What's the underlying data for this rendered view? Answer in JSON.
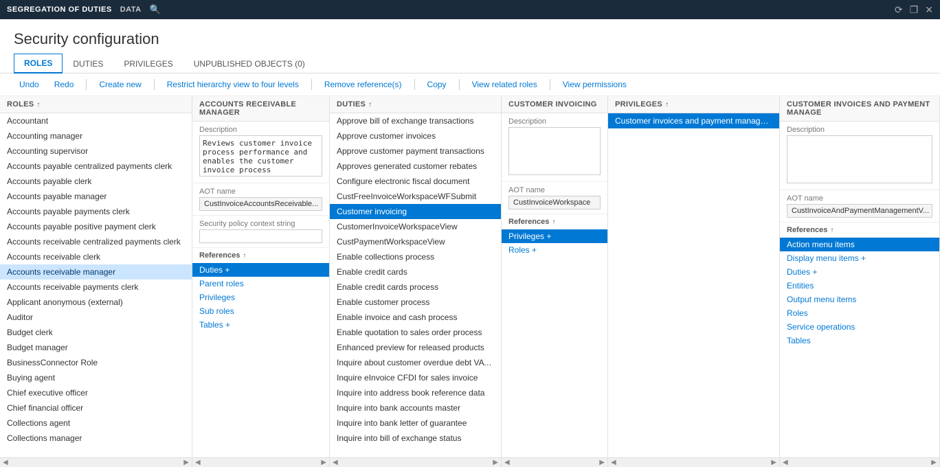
{
  "titleBar": {
    "appName": "SEGREGATION OF DUTIES",
    "menu": "DATA",
    "windowControls": [
      "⟳",
      "□",
      "✕"
    ]
  },
  "pageTitle": "Security configuration",
  "tabs": [
    {
      "label": "ROLES",
      "active": true
    },
    {
      "label": "DUTIES",
      "active": false
    },
    {
      "label": "PRIVILEGES",
      "active": false
    },
    {
      "label": "UNPUBLISHED OBJECTS (0)",
      "active": false
    }
  ],
  "toolbar": {
    "undo": "Undo",
    "redo": "Redo",
    "createNew": "Create new",
    "restrictHierarchy": "Restrict hierarchy view to four levels",
    "removeReferences": "Remove reference(s)",
    "copy": "Copy",
    "viewRelatedRoles": "View related roles",
    "viewPermissions": "View permissions"
  },
  "panels": {
    "roles": {
      "header": "Roles",
      "items": [
        "Accountant",
        "Accounting manager",
        "Accounting supervisor",
        "Accounts payable centralized payments clerk",
        "Accounts payable clerk",
        "Accounts payable manager",
        "Accounts payable payments clerk",
        "Accounts payable positive payment clerk",
        "Accounts receivable centralized payments clerk",
        "Accounts receivable clerk",
        "Accounts receivable manager",
        "Accounts receivable payments clerk",
        "Applicant anonymous (external)",
        "Auditor",
        "Budget clerk",
        "Budget manager",
        "BusinessConnector Role",
        "Buying agent",
        "Chief executive officer",
        "Chief financial officer",
        "Collections agent",
        "Collections manager"
      ],
      "selectedIndex": 10
    },
    "arManager": {
      "header": "ACCOUNTS RECEIVABLE MANAGER",
      "descriptionLabel": "Description",
      "descriptionText": "Reviews customer invoice process performance and enables the customer invoice process",
      "aotLabel": "AOT name",
      "aotValue": "CustInvoiceAccountsReceivable...",
      "securityPolicyLabel": "Security policy context string",
      "securityPolicyValue": "",
      "referencesLabel": "References",
      "refItems": [
        {
          "label": "Duties +",
          "selected": true
        },
        {
          "label": "Parent roles"
        },
        {
          "label": "Privileges"
        },
        {
          "label": "Sub roles"
        },
        {
          "label": "Tables +"
        }
      ]
    },
    "duties": {
      "header": "Duties",
      "items": [
        "Approve bill of exchange transactions",
        "Approve customer invoices",
        "Approve customer payment transactions",
        "Approves generated customer rebates",
        "Configure electronic fiscal document",
        "CustFreeInvoiceWorkspaceWFSubmit",
        "Customer invoicing",
        "CustomerInvoiceWorkspaceView",
        "CustPaymentWorkspaceView",
        "Enable collections process",
        "Enable credit cards",
        "Enable credit cards process",
        "Enable customer process",
        "Enable invoice and cash process",
        "Enable quotation to sales order process",
        "Enhanced preview for released products",
        "Inquire about customer overdue debt VAT journals",
        "Inquire eInvoice CFDI for sales invoice",
        "Inquire into address book reference data",
        "Inquire into bank accounts master",
        "Inquire into bank letter of guarantee",
        "Inquire into bill of exchange status"
      ],
      "selectedIndex": 6
    },
    "customerInvoicing": {
      "header": "CUSTOMER INVOICING",
      "descriptionLabel": "Description",
      "descriptionText": "",
      "aotLabel": "AOT name",
      "aotValue": "CustInvoiceWorkspace",
      "referencesLabel": "References",
      "refItems": [
        {
          "label": "Privileges +",
          "selected": true
        },
        {
          "label": "Roles +"
        }
      ]
    },
    "privileges": {
      "header": "Privileges",
      "items": [
        "Customer invoices and payment management"
      ],
      "selectedIndex": 0
    },
    "paymentManage": {
      "header": "CUSTOMER INVOICES AND PAYMENT MANAGE",
      "descriptionLabel": "Description",
      "descriptionText": "",
      "aotLabel": "AOT name",
      "aotValue": "CustInvoiceAndPaymentManagementV...",
      "referencesLabel": "References",
      "refItems": [
        {
          "label": "Action menu items",
          "selected": true
        },
        {
          "label": "Display menu items +"
        },
        {
          "label": "Duties +"
        },
        {
          "label": "Entities"
        },
        {
          "label": "Output menu items"
        },
        {
          "label": "Roles"
        },
        {
          "label": "Service operations"
        },
        {
          "label": "Tables"
        }
      ]
    }
  }
}
